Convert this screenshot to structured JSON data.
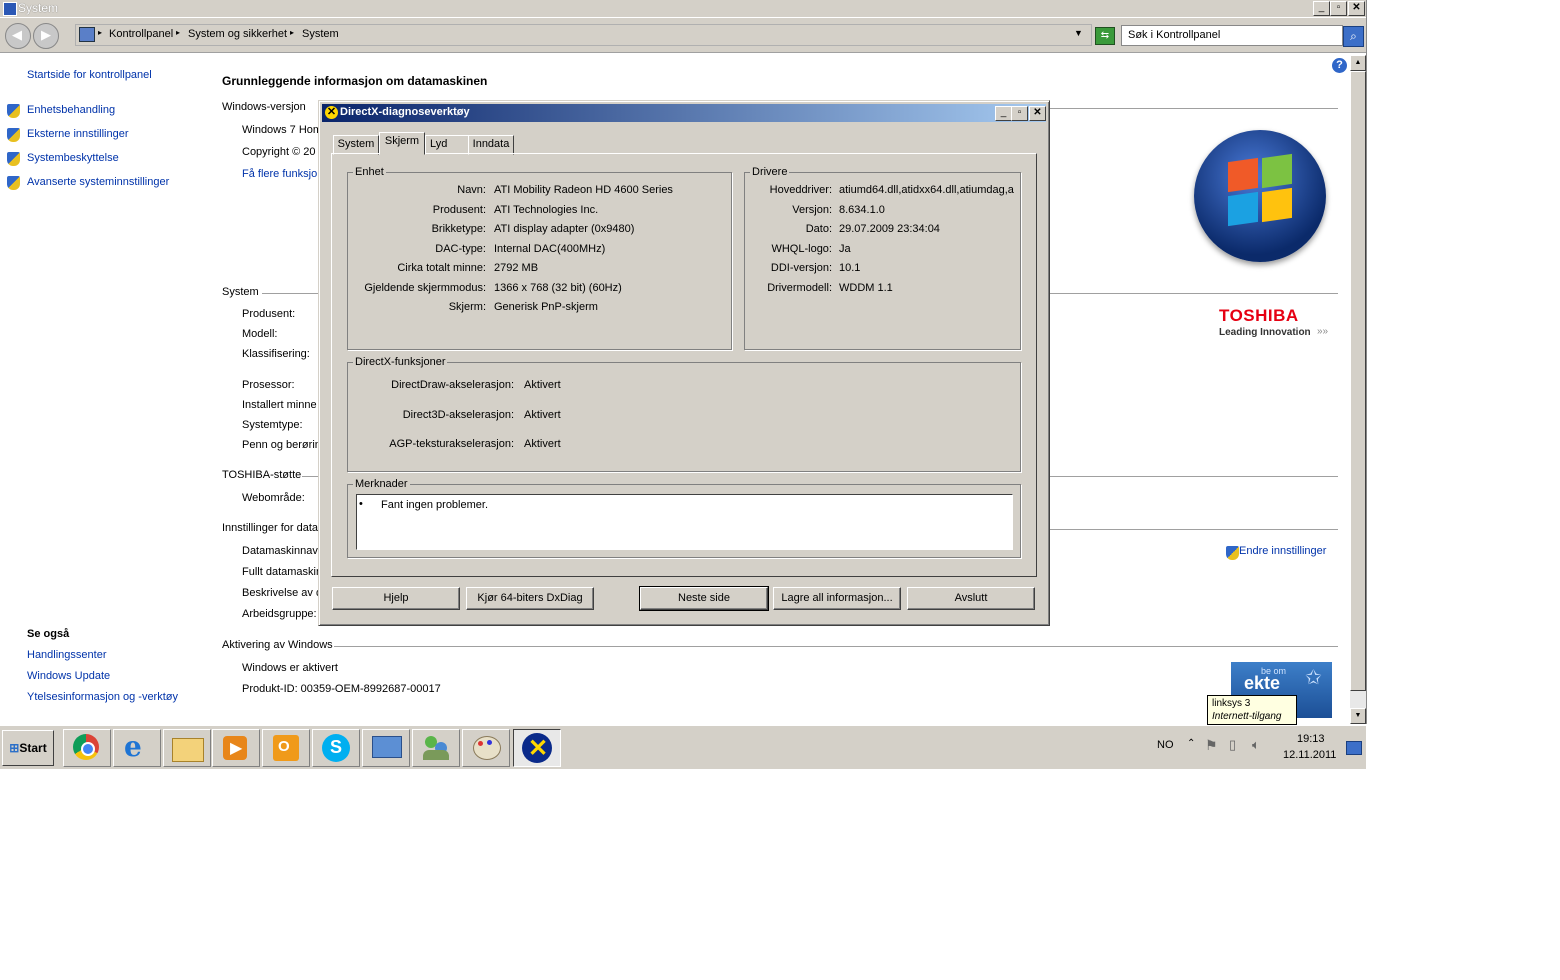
{
  "window": {
    "title": "System"
  },
  "address": {
    "crumbs": [
      "Kontrollpanel",
      "System og sikkerhet",
      "System"
    ],
    "search_placeholder": "Søk i Kontrollpanel"
  },
  "left_nav": {
    "home": "Startside for kontrollpanel",
    "items": [
      "Enhetsbehandling",
      "Eksterne innstillinger",
      "Systembeskyttelse",
      "Avanserte systeminnstillinger"
    ],
    "see_also_title": "Se også",
    "see_also": [
      "Handlingssenter",
      "Windows Update",
      "Ytelsesinformasjon og -verktøy"
    ]
  },
  "main": {
    "heading": "Grunnleggende informasjon om datamaskinen",
    "windows_section": "Windows-versjon",
    "win_lines": [
      "Windows 7 Hom",
      "Copyright © 20",
      "Få flere funksjo"
    ],
    "system_section": "System",
    "system_labels": [
      "Produsent:",
      "Modell:",
      "Klassifisering:",
      "Prosessor:",
      "Installert minne",
      "Systemtype:",
      "Penn og berørin"
    ],
    "toshiba_section": "TOSHIBA-støtte",
    "toshiba_labels": [
      "Webområde:"
    ],
    "settings_section": "Innstillinger for data",
    "settings_labels": [
      "Datamaskinnavn",
      "Fullt datamaskin",
      "Beskrivelse av d",
      "Arbeidsgruppe:"
    ],
    "change_settings": "Endre innstillinger",
    "activation_section": "Aktivering av Windows",
    "activated": "Windows er aktivert",
    "product_id": "Produkt-ID:  00359-OEM-8992687-00017",
    "toshiba_brand": "TOSHIBA",
    "toshiba_slogan": "Leading Innovation",
    "genuine_small": "be om",
    "genuine_big": "ekte",
    "tooltip_line1": "linksys  3",
    "tooltip_line2": "Internett-tilgang"
  },
  "dialog": {
    "title": "DirectX-diagnoseverktøy",
    "tabs": [
      "System",
      "Skjerm",
      "Lyd",
      "Inndata"
    ],
    "device_group": "Enhet",
    "device": [
      {
        "label": "Navn:",
        "value": "ATI Mobility Radeon HD 4600 Series"
      },
      {
        "label": "Produsent:",
        "value": "ATI Technologies Inc."
      },
      {
        "label": "Brikketype:",
        "value": "ATI display adapter (0x9480)"
      },
      {
        "label": "DAC-type:",
        "value": "Internal DAC(400MHz)"
      },
      {
        "label": "Cirka totalt minne:",
        "value": "2792 MB"
      },
      {
        "label": "Gjeldende skjermmodus:",
        "value": "1366 x 768 (32 bit) (60Hz)"
      },
      {
        "label": "Skjerm:",
        "value": "Generisk PnP-skjerm"
      }
    ],
    "drivers_group": "Drivere",
    "drivers": [
      {
        "label": "Hoveddriver:",
        "value": "atiumd64.dll,atidxx64.dll,atiumdag,a"
      },
      {
        "label": "Versjon:",
        "value": "8.634.1.0"
      },
      {
        "label": "Dato:",
        "value": "29.07.2009 23:34:04"
      },
      {
        "label": "WHQL-logo:",
        "value": "Ja"
      },
      {
        "label": "DDI-versjon:",
        "value": "10.1"
      },
      {
        "label": "Drivermodell:",
        "value": "WDDM 1.1"
      }
    ],
    "features_group": "DirectX-funksjoner",
    "features": [
      {
        "label": "DirectDraw-akselerasjon:",
        "value": "Aktivert"
      },
      {
        "label": "Direct3D-akselerasjon:",
        "value": "Aktivert"
      },
      {
        "label": "AGP-teksturakselerasjon:",
        "value": "Aktivert"
      }
    ],
    "notes_group": "Merknader",
    "notes": "Fant ingen problemer.",
    "buttons": {
      "help": "Hjelp",
      "run64": "Kjør 64-biters DxDiag",
      "next": "Neste side",
      "save": "Lagre all informasjon...",
      "exit": "Avslutt"
    }
  },
  "taskbar": {
    "start": "Start",
    "lang": "NO",
    "time": "19:13",
    "date": "12.11.2011"
  }
}
